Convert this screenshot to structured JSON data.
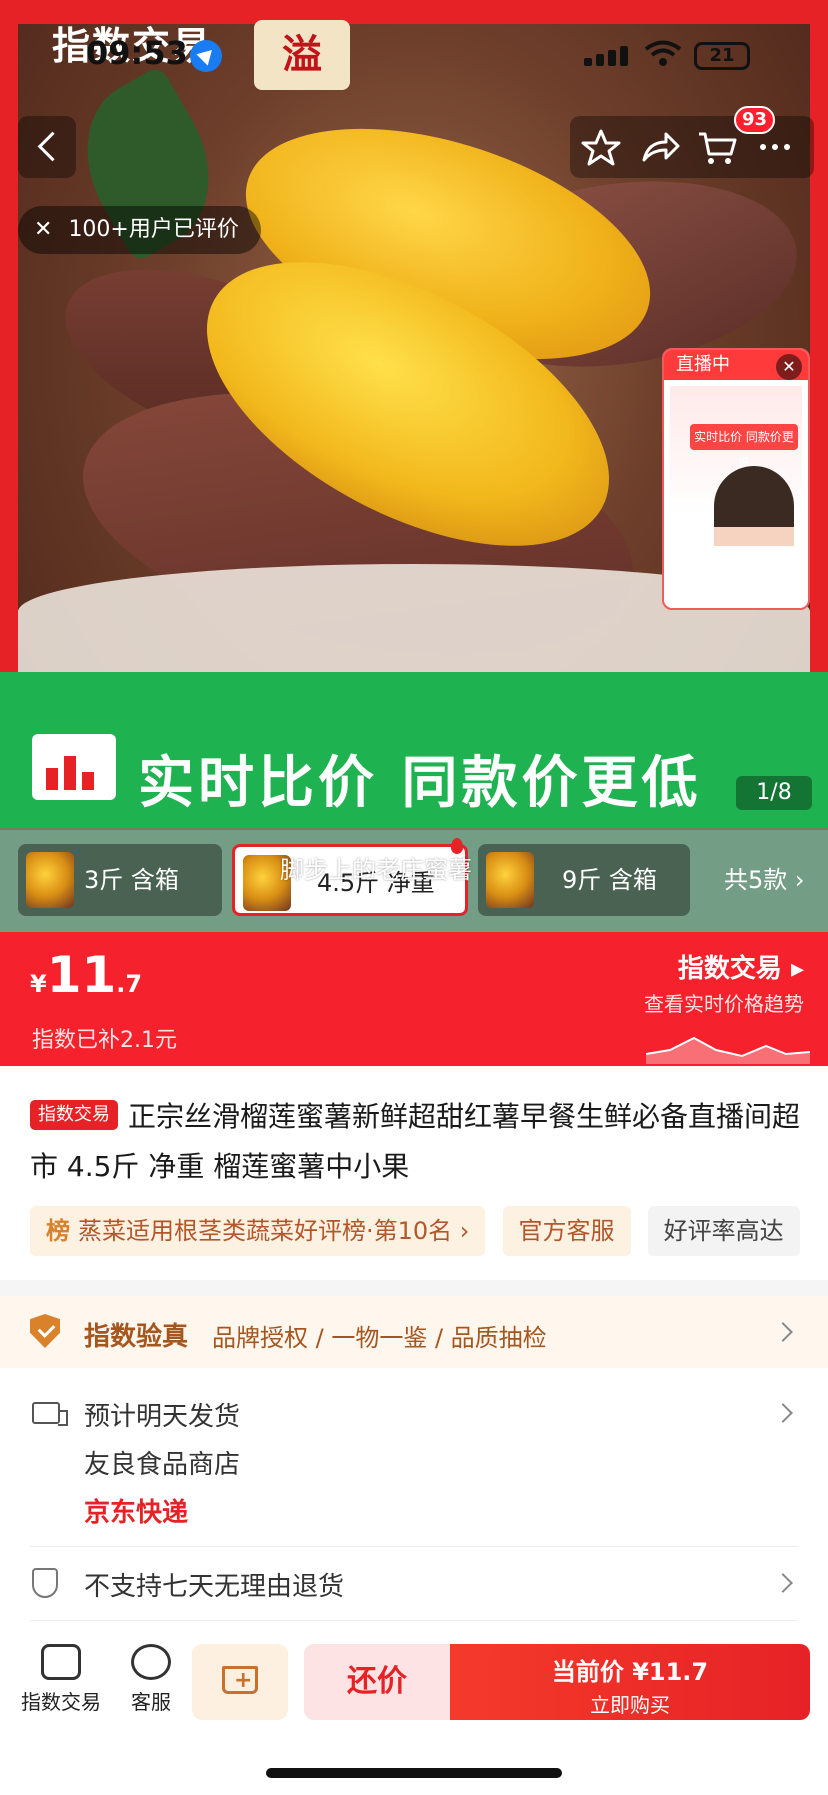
{
  "status_bar": {
    "time": "09:53",
    "battery": "21"
  },
  "hero": {
    "brand_text": "指数交易",
    "brand_badge": "溢",
    "cart_count": "93",
    "reviews_text": "100+用户已评价",
    "live_label": "直播中",
    "live_sign": "实时比价 同款价更低",
    "banner_text": "实时比价  同款价更低",
    "page_counter": "1/8"
  },
  "nav": {
    "back_icon": "back-chevron-icon",
    "actions": [
      "star-icon",
      "share-icon",
      "cart-icon",
      "more-icon"
    ]
  },
  "variants": {
    "items": [
      {
        "label": "3斤 含箱",
        "selected": false
      },
      {
        "label": "4.5斤 净重",
        "selected": true
      },
      {
        "label": "9斤 含箱",
        "selected": false
      }
    ],
    "total": "共5款",
    "caption": "脚步上的老庄蜜薯"
  },
  "price": {
    "currency": "¥",
    "integer": "11",
    "decimal": ".7",
    "subsidy": "指数已补2.1元",
    "trend_title": "指数交易",
    "trend_sub": "查看实时价格趋势"
  },
  "product": {
    "badge": "指数交易",
    "title": "正宗丝滑榴莲蜜薯新鲜超甜红薯早餐生鲜必备直播间超市 4.5斤 净重 榴莲蜜薯中小果"
  },
  "tags": {
    "rank_prefix": "榜",
    "rank_text": "蒸菜适用根茎类蔬菜好评榜·第10名",
    "service": "官方客服",
    "rating": "好评率高达"
  },
  "verify": {
    "title": "指数验真",
    "items": "品牌授权 / 一物一鉴 / 品质抽检"
  },
  "shipping": {
    "line1": "预计明天发货",
    "line2": "友良食品商店",
    "courier": "京东快递"
  },
  "returns": {
    "text": "不支持七天无理由退货"
  },
  "bottom_bar": {
    "index_trade": "指数交易",
    "service": "客服",
    "bargain": "还价",
    "buy_price": "当前价 ¥11.7",
    "buy_label": "立即购买"
  },
  "colors": {
    "accent_red": "#e62226",
    "banner_green": "#1fb251",
    "gold": "#a5561f"
  }
}
